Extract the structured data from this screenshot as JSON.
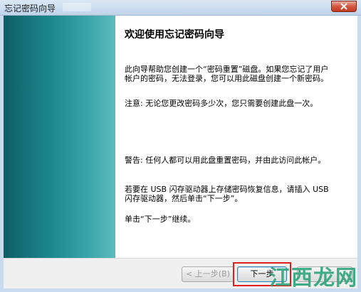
{
  "window": {
    "title": "忘记密码向导"
  },
  "wizard": {
    "heading": "欢迎使用忘记密码向导",
    "paragraphs": [
      "此向导帮助您创建一个“密码重置”磁盘。如果您忘记了用户帐户的密码，无法登录，您可以用此磁盘创建一个新密码。",
      "注意: 无论您更改密码多少次，您只需要创建此盘一次。",
      "警告: 任何人都可以用此盘重置密码，并由此访问此帐户。",
      "若要在 USB 闪存驱动器上存储密码恢复信息，请插入 USB 闪存驱动器，然后单击“下一步”。",
      "单击“下一步”继续。"
    ]
  },
  "buttons": {
    "back": "< 上一步(B)",
    "next": "下一步",
    "cancel": ""
  },
  "watermark": {
    "text": "江西龙网"
  },
  "colors": {
    "highlight": "#e02020",
    "panel_dark": "#0f5f67",
    "panel_light": "#5bbcbe",
    "watermark": "#2aa27a"
  }
}
